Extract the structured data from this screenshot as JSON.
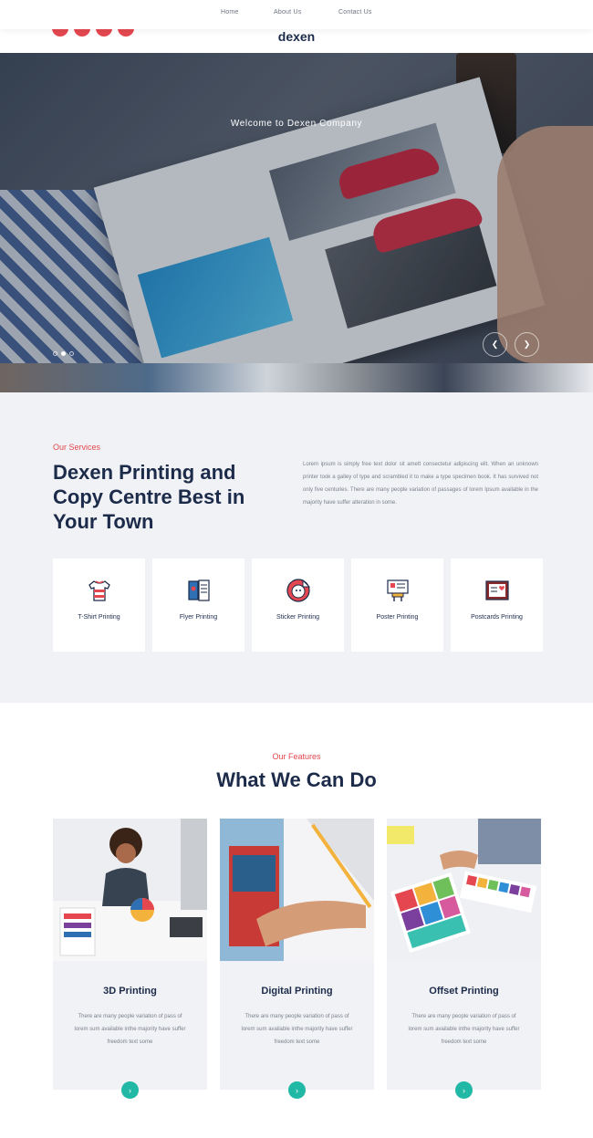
{
  "nav": {
    "items": [
      "Home",
      "About Us",
      "Contact Us"
    ]
  },
  "brand": {
    "logo": "dexen"
  },
  "colors": {
    "accent": "#e4474f",
    "navy": "#1c2b4a",
    "teal": "#22b8a6"
  },
  "hero": {
    "title": "Welcome to Dexen Company",
    "prev_icon": "chevron-left-icon",
    "next_icon": "chevron-right-icon"
  },
  "services": {
    "eyebrow": "Our Services",
    "heading": "Dexen Printing and Copy Centre Best in Your Town",
    "text": "Lorem ipsum is simply free text dolor sit amett consectetur adipiscing elit. When an unknown printer took a galley of type and scrambled it to make a type specimen book. It has survived not only five centuries. There are many people variation of passages of lorem Ipsum available in the majority have suffer alteration in some.",
    "cards": [
      {
        "label": "T-Shirt Printing",
        "icon": "tshirt-icon"
      },
      {
        "label": "Flyer Printing",
        "icon": "flyer-icon"
      },
      {
        "label": "Sticker Printing",
        "icon": "sticker-icon"
      },
      {
        "label": "Poster Printing",
        "icon": "poster-icon"
      },
      {
        "label": "Postcards Printing",
        "icon": "postcard-icon"
      }
    ]
  },
  "features": {
    "eyebrow": "Our Features",
    "heading": "What We Can Do",
    "items": [
      {
        "title": "3D Printing",
        "text": "There are many people variation of pass of lorem sum available inthe majority have suffer freedom text some"
      },
      {
        "title": "Digital Printing",
        "text": "There are many people variation of pass of lorem sum available inthe majority have suffer freedom text some"
      },
      {
        "title": "Offset Printing",
        "text": "There are many people variation of pass of lorem sum available inthe majority have suffer freedom text some"
      }
    ]
  }
}
